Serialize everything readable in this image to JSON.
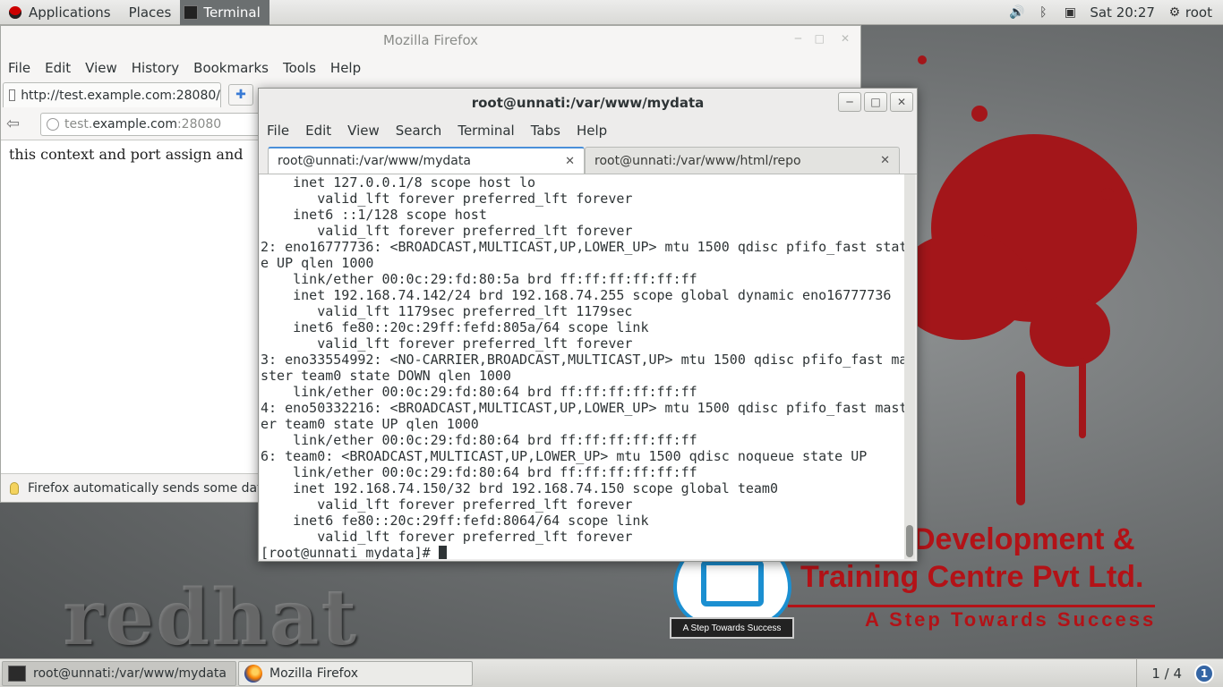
{
  "top_panel": {
    "applications": "Applications",
    "places": "Places",
    "active_task": "Terminal",
    "clock": "Sat 20:27",
    "user": "root",
    "icons": [
      "volume-icon",
      "bluetooth-icon",
      "network-icon",
      "user-icon"
    ]
  },
  "wallpaper": {
    "redhat_text": "redhat",
    "brand_line1": "Development &",
    "brand_line2": "Training Centre Pvt Ltd.",
    "brand_tagline": "A Step Towards Success",
    "logo_caption": "A Step Towards Success",
    "accent_color": "#b31217"
  },
  "firefox": {
    "title": "Mozilla Firefox",
    "menu": [
      "File",
      "Edit",
      "View",
      "History",
      "Bookmarks",
      "Tools",
      "Help"
    ],
    "tab_label": "http://test.example.com:28080/",
    "url_prefix": "test.",
    "url_host": "example.com",
    "url_port": ":28080",
    "content_text": "this context and port assign and",
    "notification": "Firefox automatically sends some data t"
  },
  "terminal": {
    "title": "root@unnati:/var/www/mydata",
    "menu": [
      "File",
      "Edit",
      "View",
      "Search",
      "Terminal",
      "Tabs",
      "Help"
    ],
    "tabs": [
      "root@unnati:/var/www/mydata",
      "root@unnati:/var/www/html/repo"
    ],
    "lines": [
      "    inet 127.0.0.1/8 scope host lo",
      "       valid_lft forever preferred_lft forever",
      "    inet6 ::1/128 scope host",
      "       valid_lft forever preferred_lft forever",
      "2: eno16777736: <BROADCAST,MULTICAST,UP,LOWER_UP> mtu 1500 qdisc pfifo_fast stat",
      "e UP qlen 1000",
      "    link/ether 00:0c:29:fd:80:5a brd ff:ff:ff:ff:ff:ff",
      "    inet 192.168.74.142/24 brd 192.168.74.255 scope global dynamic eno16777736",
      "       valid_lft 1179sec preferred_lft 1179sec",
      "    inet6 fe80::20c:29ff:fefd:805a/64 scope link",
      "       valid_lft forever preferred_lft forever",
      "3: eno33554992: <NO-CARRIER,BROADCAST,MULTICAST,UP> mtu 1500 qdisc pfifo_fast ma",
      "ster team0 state DOWN qlen 1000",
      "    link/ether 00:0c:29:fd:80:64 brd ff:ff:ff:ff:ff:ff",
      "4: eno50332216: <BROADCAST,MULTICAST,UP,LOWER_UP> mtu 1500 qdisc pfifo_fast mast",
      "er team0 state UP qlen 1000",
      "    link/ether 00:0c:29:fd:80:64 brd ff:ff:ff:ff:ff:ff",
      "6: team0: <BROADCAST,MULTICAST,UP,LOWER_UP> mtu 1500 qdisc noqueue state UP",
      "    link/ether 00:0c:29:fd:80:64 brd ff:ff:ff:ff:ff:ff",
      "    inet 192.168.74.150/32 brd 192.168.74.150 scope global team0",
      "       valid_lft forever preferred_lft forever",
      "    inet6 fe80::20c:29ff:fefd:8064/64 scope link",
      "       valid_lft forever preferred_lft forever"
    ],
    "prompt": "[root@unnati mydata]# "
  },
  "taskbar": {
    "tasks": [
      "root@unnati:/var/www/mydata",
      "Mozilla Firefox"
    ],
    "workspace": "1 / 4",
    "notification_count": "1"
  }
}
